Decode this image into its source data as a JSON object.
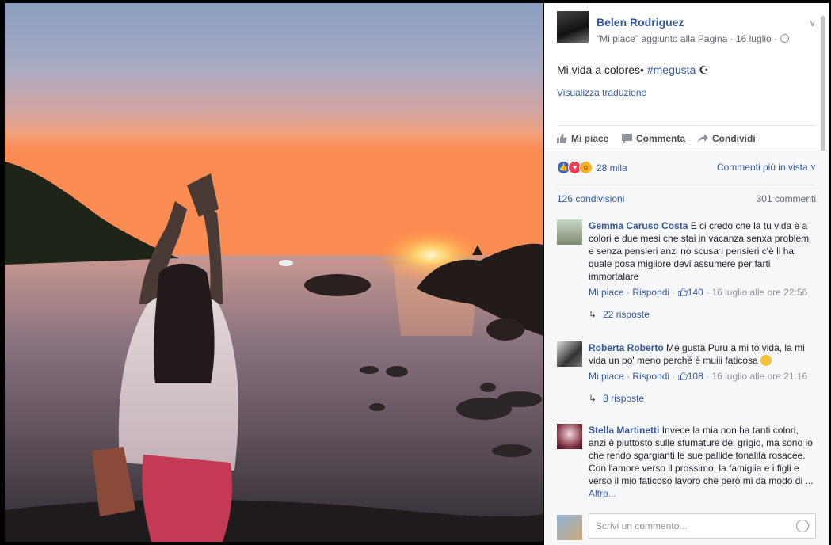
{
  "post": {
    "author": "Belen Rodriguez",
    "subtitle": "\"Mi piace\" aggiunto alla Pagina · 16 luglio ·",
    "text_main": "Mi vida a colores• ",
    "hashtag": "#megusta",
    "text_tail": " ☪",
    "translate_link": "Visualizza traduzione"
  },
  "actions": {
    "like": "Mi piace",
    "comment": "Commenta",
    "share": "Condividi"
  },
  "stats": {
    "reactions_count": "28 mila",
    "sort_label": "Commenti più in vista ˅",
    "shares": "126 condivisioni",
    "comments": "301 commenti"
  },
  "comments": [
    {
      "author": "Gemma Caruso Costa",
      "text": "E ci credo che la tu vida è a colori e due mesi che stai in vacanza senxa problemi e senza pensieri anzi no scusa i pensieri c'è li hai quale posa migliore devi assumere per farti immortalare",
      "like": "Mi piace",
      "reply": "Rispondi",
      "likes": "140",
      "time": "16 luglio alle ore 22:56",
      "replies": "22 risposte"
    },
    {
      "author": "Roberta Roberto",
      "text": "Me gusta Puru a mi to vida, la mi vida un po' meno perché è muiii faticosa",
      "like": "Mi piace",
      "reply": "Rispondi",
      "likes": "108",
      "time": "16 luglio alle ore 21:16",
      "replies": "8 risposte"
    },
    {
      "author": "Stella Martinetti",
      "text": "Invece la mia non ha tanti colori, anzi è piuttosto sulle sfumature del grigio, ma sono io che rendo sgargianti le sue pallide tonalità rosacee. Con l'amore verso il prossimo, la famiglia e i figli e verso il mio faticoso lavoro che però mi da modo di ...",
      "more": "Altro..."
    }
  ],
  "composer": {
    "placeholder": "Scrivi un commento..."
  },
  "colors": {
    "link": "#365899",
    "like_reaction": "#4267b2",
    "love_reaction": "#f33e58",
    "wow_reaction": "#f7b125"
  }
}
